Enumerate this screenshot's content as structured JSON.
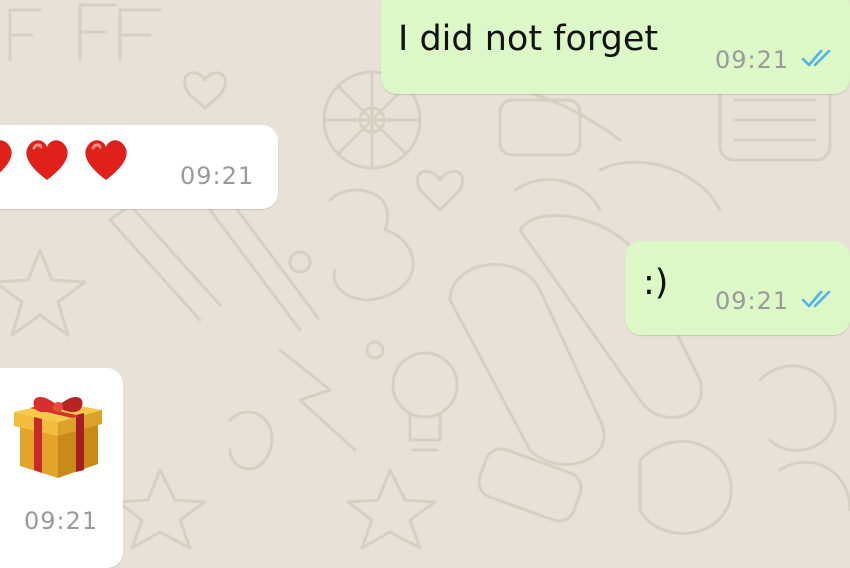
{
  "chat": {
    "messages": [
      {
        "direction": "outgoing",
        "text": "I did not forget",
        "time": "09:21",
        "status": "read"
      },
      {
        "direction": "incoming",
        "content_icons": [
          "red-heart-emoji",
          "red-heart-emoji",
          "red-heart-emoji"
        ],
        "time": "09:21"
      },
      {
        "direction": "outgoing",
        "text": ":)",
        "time": "09:21",
        "status": "read"
      },
      {
        "direction": "incoming",
        "content_icons": [
          "wrapped-gift-emoji"
        ],
        "time": "09:21"
      }
    ]
  },
  "colors": {
    "chat_background": "#e7e1d8",
    "outgoing_bubble": "#dcf8c6",
    "incoming_bubble": "#ffffff",
    "read_ticks": "#4fb3e8",
    "timestamp": "#9a9a9a"
  }
}
